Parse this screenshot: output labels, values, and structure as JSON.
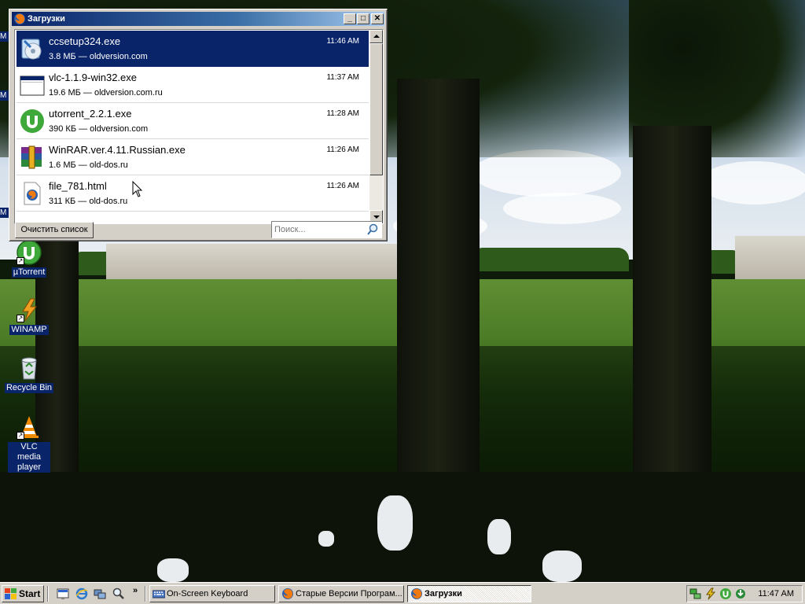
{
  "desktop": {
    "icons": [
      {
        "label": "µTorrent",
        "icon": "utorrent-icon"
      },
      {
        "label": "WINAMP",
        "icon": "winamp-icon"
      },
      {
        "label": "Recycle Bin",
        "icon": "recycle-bin-icon"
      },
      {
        "label": "VLC media player",
        "icon": "vlc-icon"
      }
    ],
    "edge_stubs": [
      "M",
      "M",
      "M"
    ]
  },
  "downloads_window": {
    "title": "Загрузки",
    "controls": {
      "minimize": "_",
      "maximize": "□",
      "close": "✕"
    },
    "items": [
      {
        "filename": "ccsetup324.exe",
        "meta": "3.8 МБ — oldversion.com",
        "time": "11:46 AM",
        "icon": "ccleaner-installer-icon",
        "selected": true
      },
      {
        "filename": "vlc-1.1.9-win32.exe",
        "meta": "19.6 МБ — oldversion.com.ru",
        "time": "11:37 AM",
        "icon": "application-window-icon",
        "selected": false
      },
      {
        "filename": "utorrent_2.2.1.exe",
        "meta": "390 КБ — oldversion.com",
        "time": "11:28 AM",
        "icon": "utorrent-icon",
        "selected": false
      },
      {
        "filename": "WinRAR.ver.4.11.Russian.exe",
        "meta": "1.6 МБ — old-dos.ru",
        "time": "11:26 AM",
        "icon": "winrar-icon",
        "selected": false
      },
      {
        "filename": "file_781.html",
        "meta": "311 КБ — old-dos.ru",
        "time": "11:26 AM",
        "icon": "firefox-document-icon",
        "selected": false
      }
    ],
    "clear_button": "Очистить список",
    "search": {
      "value": "",
      "placeholder": "Поиск..."
    }
  },
  "taskbar": {
    "start_label": "Start",
    "quick_launch": [
      "show-desktop-icon",
      "internet-explorer-icon",
      "network-icon",
      "search-icon"
    ],
    "quick_launch_more": "»",
    "tasks": [
      {
        "label": "On-Screen Keyboard",
        "icon": "keyboard-icon",
        "active": false
      },
      {
        "label": "Старые Версии Програм...",
        "icon": "firefox-icon",
        "active": false
      },
      {
        "label": "Загрузки",
        "icon": "firefox-icon",
        "active": true
      }
    ],
    "tray_icons": [
      "network-connection-icon",
      "power-icon",
      "utorrent-tray-icon",
      "update-icon"
    ],
    "clock": "11:47 AM"
  },
  "colors": {
    "selection": "#0a246a",
    "title_gradient_start": "#0a246a",
    "title_gradient_end": "#a6caf0",
    "window_face": "#d4d0c8"
  }
}
